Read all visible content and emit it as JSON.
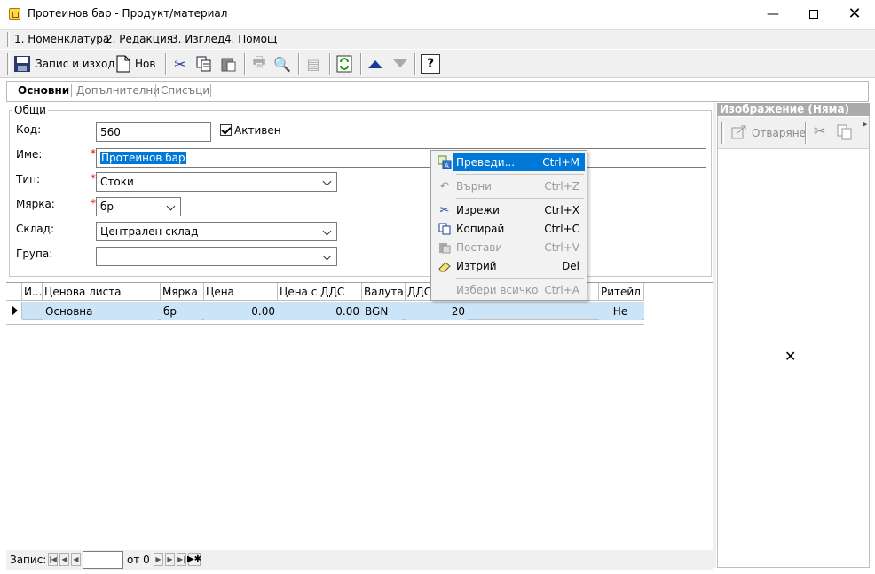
{
  "window": {
    "title": "Протеинов бар - Продукт/материал"
  },
  "menu": [
    "1. Номенклатура",
    "2. Редакция",
    "3. Изглед",
    "4. Помощ"
  ],
  "toolbar": {
    "save_exit": "Запис и изход",
    "new": "Нов"
  },
  "tabs": [
    "Основни",
    "Допълнителни",
    "Списъци"
  ],
  "group": {
    "legend": "Общи",
    "code_label": "Код:",
    "code_value": "560",
    "active_label": "Активен",
    "name_label": "Име:",
    "name_value": "Протеинов бар",
    "type_label": "Тип:",
    "type_value": "Стоки",
    "unit_label": "Мярка:",
    "unit_value": "бр",
    "warehouse_label": "Склад:",
    "warehouse_value": "Централен склад",
    "group_label": "Група:",
    "group_value": "",
    "required_mark": "*"
  },
  "grid": {
    "headers": [
      "И...",
      "Ценова листа",
      "Мярка",
      "Цена",
      "Цена с ДДС",
      "Валута",
      "ДДС",
      "Ритейл"
    ],
    "row": [
      "Основна",
      "бр",
      "0.00",
      "0.00",
      "BGN",
      "20",
      "Не"
    ]
  },
  "image_panel": {
    "title": "Изображение (Няма)",
    "open_label": "Отваряне"
  },
  "context_menu": [
    {
      "label": "Преведи...",
      "shortcut": "Ctrl+M",
      "enabled": true,
      "icon": "translate-icon"
    },
    {
      "label": "Върни",
      "shortcut": "Ctrl+Z",
      "enabled": false,
      "icon": "undo-icon"
    },
    {
      "label": "Изрежи",
      "shortcut": "Ctrl+X",
      "enabled": true,
      "icon": "scissors-icon"
    },
    {
      "label": "Копирай",
      "shortcut": "Ctrl+C",
      "enabled": true,
      "icon": "copy-icon"
    },
    {
      "label": "Постави",
      "shortcut": "Ctrl+V",
      "enabled": false,
      "icon": "paste-icon"
    },
    {
      "label": "Изтрий",
      "shortcut": "Del",
      "enabled": true,
      "icon": "eraser-icon"
    },
    {
      "label": "Избери всичко",
      "shortcut": "Ctrl+A",
      "enabled": false,
      "icon": ""
    }
  ],
  "status": {
    "record_label": "Запис:",
    "record_value": "",
    "of_text": "от 0"
  },
  "colors": {
    "selection": "#0078d7",
    "row_highlight": "#cce4f7",
    "panel_header": "#ababab"
  }
}
